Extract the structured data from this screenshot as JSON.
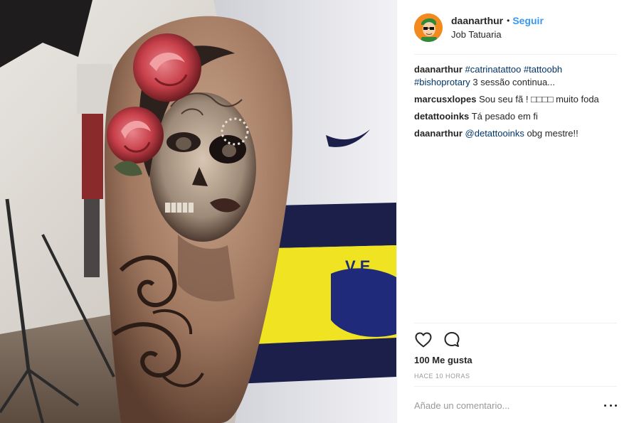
{
  "header": {
    "username": "daanarthur",
    "separator": "•",
    "follow_label": "Seguir",
    "location": "Job Tatuaria"
  },
  "comments": [
    {
      "user": "daanarthur",
      "parts": [
        {
          "type": "tag",
          "text": "#catrinatattoo"
        },
        {
          "type": "text",
          "text": " "
        },
        {
          "type": "tag",
          "text": "#tattoobh"
        },
        {
          "type": "text",
          "text": " "
        },
        {
          "type": "tag",
          "text": "#bishoprotary"
        },
        {
          "type": "text",
          "text": " 3 sessão continua..."
        }
      ]
    },
    {
      "user": "marcusxlopes",
      "parts": [
        {
          "type": "text",
          "text": "Sou seu fã ! □□□□ muito foda"
        }
      ]
    },
    {
      "user": "detattooinks",
      "parts": [
        {
          "type": "text",
          "text": "Tá pesado em fi"
        }
      ]
    },
    {
      "user": "daanarthur",
      "parts": [
        {
          "type": "tag",
          "text": "@detattooinks"
        },
        {
          "type": "text",
          "text": " obg mestre!!"
        }
      ]
    }
  ],
  "actions": {
    "like_icon": "heart-icon",
    "comment_icon": "comment-bubble-icon"
  },
  "likes_text": "100 Me gusta",
  "timestamp": "HACE 10 HORAS",
  "comment_input": {
    "placeholder": "Añade un comentario...",
    "value": ""
  },
  "more_icon": "more-options-icon",
  "colors": {
    "link_blue": "#3897f0",
    "tag_blue": "#003569",
    "muted_gray": "#999999",
    "text": "#262626",
    "divider": "#efefef"
  }
}
